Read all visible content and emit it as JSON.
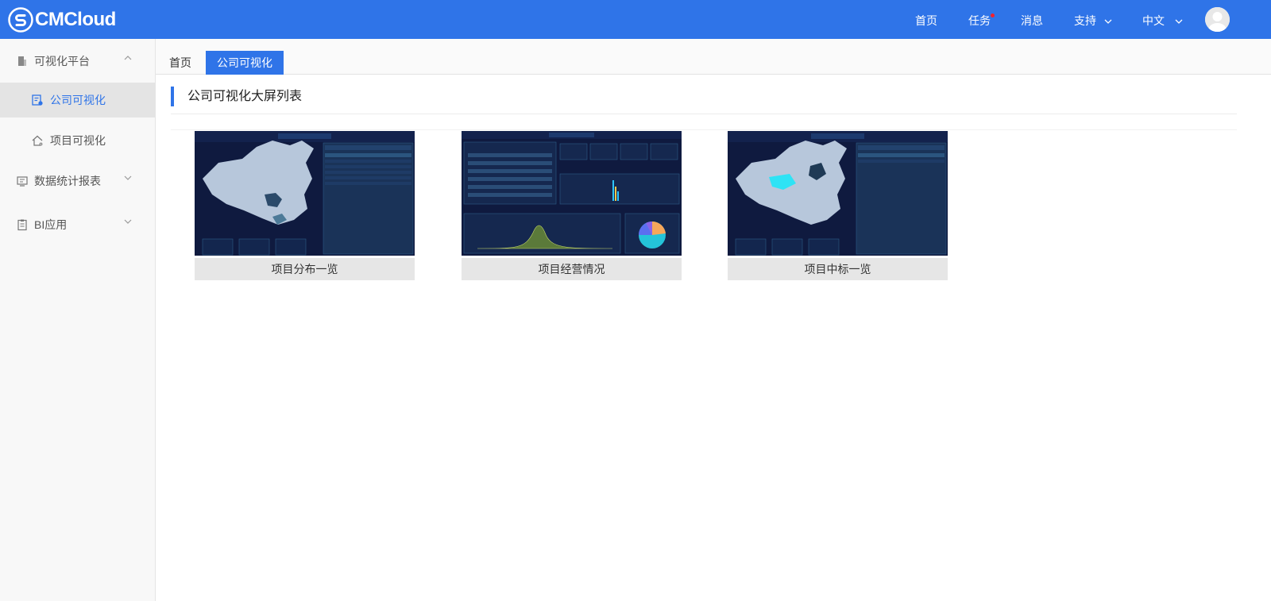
{
  "header": {
    "logo_text": "CMCloud",
    "nav": {
      "home": "首页",
      "tasks": "任务",
      "messages": "消息",
      "support": "支持",
      "language": "中文"
    }
  },
  "sidebar": {
    "groups": [
      {
        "label": "可视化平台",
        "icon": "building-icon",
        "expanded": true,
        "children": [
          {
            "label": "公司可视化",
            "icon": "document-chart-icon",
            "active": true
          },
          {
            "label": "项目可视化",
            "icon": "home-outline-icon",
            "active": false
          }
        ]
      },
      {
        "label": "数据统计报表",
        "icon": "report-icon",
        "expanded": false
      },
      {
        "label": "BI应用",
        "icon": "clipboard-icon",
        "expanded": false
      }
    ]
  },
  "tabs": {
    "home": "首页",
    "active": "公司可视化"
  },
  "main": {
    "section_title": "公司可视化大屏列表",
    "cards": [
      {
        "caption": "项目分布一览"
      },
      {
        "caption": "项目经营情况"
      },
      {
        "caption": "项目中标一览"
      }
    ]
  },
  "colors": {
    "primary": "#2f74e8",
    "dashboard_bg": "#0f1a3f",
    "map_fill": "#b7c7db",
    "alert_dot": "#f5222d"
  }
}
